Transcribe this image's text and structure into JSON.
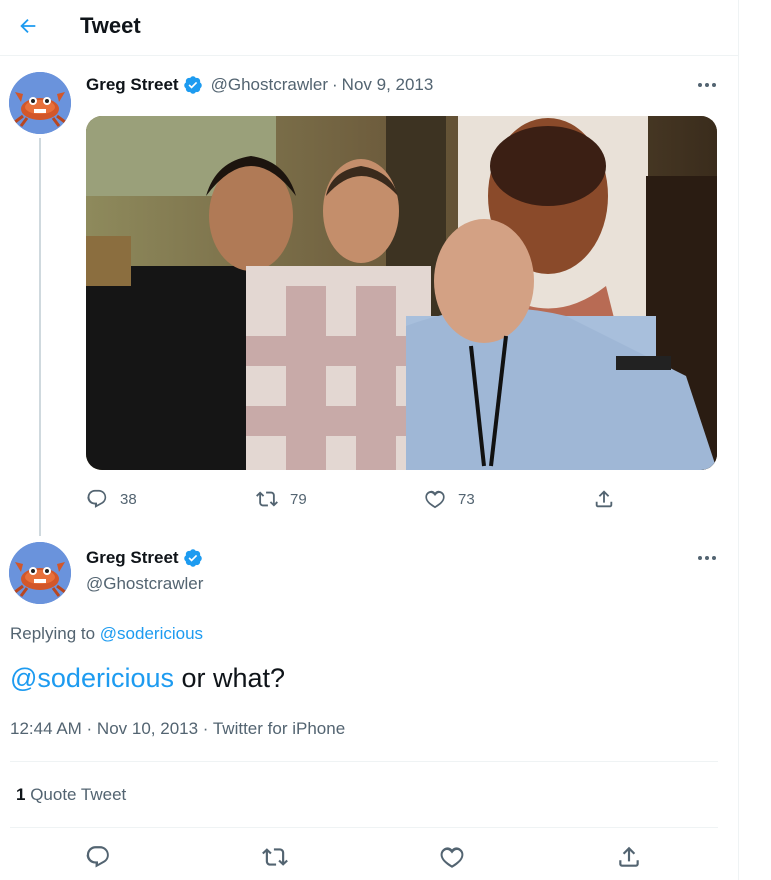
{
  "header": {
    "title": "Tweet",
    "back_icon": "arrow-left-icon"
  },
  "colors": {
    "accent": "#1d9bf0",
    "text": "#0f1419",
    "muted": "#536471",
    "divider": "#eff3f4"
  },
  "tweet": {
    "author_name": "Greg Street",
    "author_handle": "@Ghostcrawler",
    "date": "Nov 9, 2013",
    "date_sep": "·",
    "verified_icon": "verified-badge-icon",
    "media": "photo of three men posing in front of a portrait",
    "actions": {
      "replies": "38",
      "retweets": "79",
      "likes": "73"
    }
  },
  "reply": {
    "author_name": "Greg Street",
    "author_handle": "@Ghostcrawler",
    "replying_to_label": "Replying to",
    "replying_to_handle": "@sodericious",
    "mention": "@sodericious",
    "text": " or what?",
    "timestamp": "12:44 AM · Nov 10, 2013 · Twitter for iPhone",
    "quote_count": "1",
    "quote_label": "Quote Tweet"
  }
}
